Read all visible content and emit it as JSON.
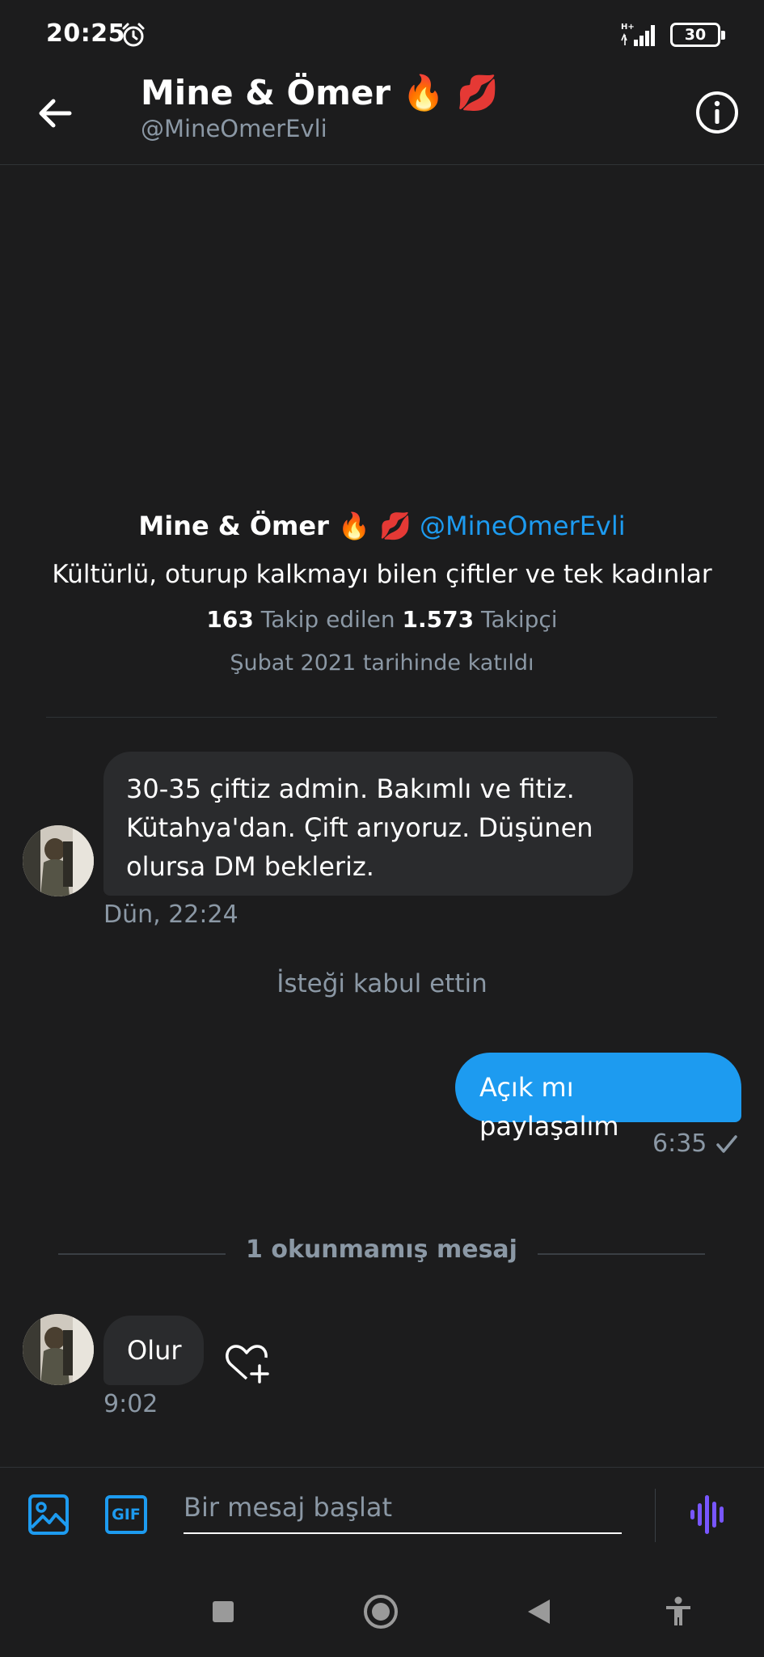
{
  "status_bar": {
    "time": "20:25",
    "network": "H+",
    "battery": "30"
  },
  "header": {
    "title": "Mine & Ömer 🔥 💋",
    "handle": "@MineOmerEvli"
  },
  "profile": {
    "name": "Mine & Ömer 🔥 💋",
    "handle": "@MineOmerEvli",
    "bio": "Kültürlü, oturup kalkmayı bilen çiftler ve tek kadınlar",
    "following_count": "163",
    "following_label": "Takip edilen",
    "followers_count": "1.573",
    "followers_label": "Takipçi",
    "joined": "Şubat 2021 tarihinde katıldı"
  },
  "messages": [
    {
      "direction": "incoming",
      "text": "30-35 çiftiz admin. Bakımlı ve fitiz. Kütahya'dan. Çift arıyoruz. Düşünen olursa DM bekleriz.",
      "time": "Dün, 22:24"
    },
    {
      "direction": "outgoing",
      "text": "Açık mı paylaşalım",
      "time": "6:35",
      "status": "sent"
    },
    {
      "direction": "incoming",
      "text": "Olur",
      "time": "9:02"
    }
  ],
  "system_note": "İsteği kabul ettin",
  "unread_separator": "1 okunmamış mesaj",
  "composer": {
    "placeholder": "Bir mesaj başlat",
    "gif_label": "GIF"
  },
  "colors": {
    "background": "#1c1c1d",
    "accent": "#1d9bf0",
    "bubble_incoming": "#2a2b2d",
    "voice_icon": "#7856ff"
  },
  "icons": [
    "back-arrow-icon",
    "info-icon",
    "alarm-icon",
    "signal-icon",
    "image-icon",
    "gif-icon",
    "voice-icon",
    "heart-plus-icon",
    "checkmark-icon"
  ]
}
